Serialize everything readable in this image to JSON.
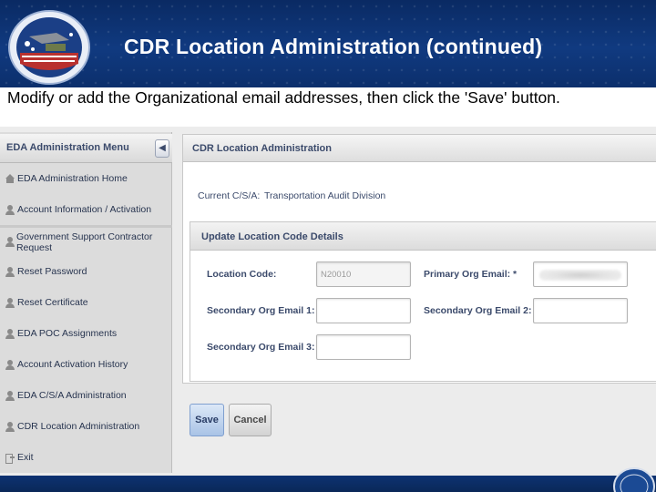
{
  "slide": {
    "title": "CDR Location Administration (continued)",
    "instruction": "Modify or add the Organizational email addresses, then click the 'Save' button."
  },
  "sidebar": {
    "title": "EDA Administration Menu",
    "collapse_icon": "chevron-left-icon",
    "items": [
      {
        "label": "EDA Administration Home",
        "icon": "home-icon"
      },
      {
        "label": "Account Information / Activation",
        "icon": "user-icon"
      },
      {
        "label": "Government Support Contractor Request",
        "icon": "user-icon"
      },
      {
        "label": "Reset Password",
        "icon": "user-icon"
      },
      {
        "label": "Reset Certificate",
        "icon": "user-icon"
      },
      {
        "label": "EDA POC Assignments",
        "icon": "user-icon"
      },
      {
        "label": "Account Activation History",
        "icon": "user-icon"
      },
      {
        "label": "EDA C/S/A Administration",
        "icon": "user-icon"
      },
      {
        "label": "CDR Location Administration",
        "icon": "user-icon"
      },
      {
        "label": "Exit",
        "icon": "exit-icon"
      }
    ]
  },
  "main": {
    "title": "CDR Location Administration",
    "current_csa_label": "Current C/S/A:",
    "current_csa_value": "Transportation Audit Division",
    "details": {
      "title": "Update Location Code Details",
      "location_code_label": "Location Code:",
      "location_code_value": "N20010",
      "primary_email_label": "Primary Org Email: *",
      "secondary_email1_label": "Secondary Org Email 1:",
      "secondary_email2_label": "Secondary Org Email 2:",
      "secondary_email3_label": "Secondary Org Email 3:"
    }
  },
  "buttons": {
    "save": "Save",
    "cancel": "Cancel"
  },
  "colors": {
    "header_blue": "#0a2a63",
    "label_text": "#3b4a6b",
    "save_button": "#a9c3e6"
  }
}
